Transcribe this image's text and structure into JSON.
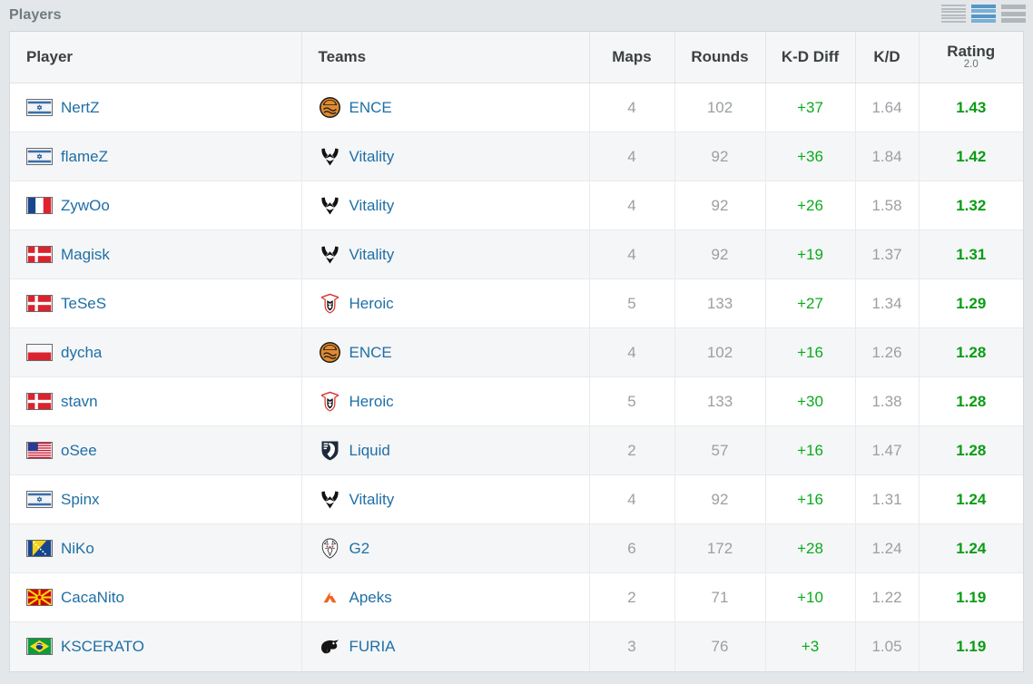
{
  "header": {
    "title": "Players",
    "view_toggles": [
      {
        "name": "compact-view-icon",
        "selected": false
      },
      {
        "name": "normal-view-icon",
        "selected": true
      },
      {
        "name": "large-view-icon",
        "selected": false
      }
    ]
  },
  "colors": {
    "page_bg": "#e3e7e9",
    "title": "#707b80",
    "link": "#1f6fa5",
    "muted_number": "#9b9fa3",
    "positive_green": "#0aab1b",
    "rating_green": "#099c14",
    "accent_blue": "#5596c4",
    "row_alt": "#f5f6f7"
  },
  "table": {
    "columns": [
      {
        "key": "player",
        "label": "Player",
        "align": "left"
      },
      {
        "key": "team",
        "label": "Teams",
        "align": "left"
      },
      {
        "key": "maps",
        "label": "Maps",
        "align": "center"
      },
      {
        "key": "rounds",
        "label": "Rounds",
        "align": "center"
      },
      {
        "key": "kd_diff",
        "label": "K-D Diff",
        "align": "center"
      },
      {
        "key": "kd",
        "label": "K/D",
        "align": "center"
      },
      {
        "key": "rating",
        "label": "Rating",
        "sublabel": "2.0",
        "align": "center"
      }
    ],
    "rows": [
      {
        "player": "NertZ",
        "country": "Israel",
        "team": "ENCE",
        "maps": "4",
        "rounds": "102",
        "kd_diff": "+37",
        "kd": "1.64",
        "rating": "1.43"
      },
      {
        "player": "flameZ",
        "country": "Israel",
        "team": "Vitality",
        "maps": "4",
        "rounds": "92",
        "kd_diff": "+36",
        "kd": "1.84",
        "rating": "1.42"
      },
      {
        "player": "ZywOo",
        "country": "France",
        "team": "Vitality",
        "maps": "4",
        "rounds": "92",
        "kd_diff": "+26",
        "kd": "1.58",
        "rating": "1.32"
      },
      {
        "player": "Magisk",
        "country": "Denmark",
        "team": "Vitality",
        "maps": "4",
        "rounds": "92",
        "kd_diff": "+19",
        "kd": "1.37",
        "rating": "1.31"
      },
      {
        "player": "TeSeS",
        "country": "Denmark",
        "team": "Heroic",
        "maps": "5",
        "rounds": "133",
        "kd_diff": "+27",
        "kd": "1.34",
        "rating": "1.29"
      },
      {
        "player": "dycha",
        "country": "Poland",
        "team": "ENCE",
        "maps": "4",
        "rounds": "102",
        "kd_diff": "+16",
        "kd": "1.26",
        "rating": "1.28"
      },
      {
        "player": "stavn",
        "country": "Denmark",
        "team": "Heroic",
        "maps": "5",
        "rounds": "133",
        "kd_diff": "+30",
        "kd": "1.38",
        "rating": "1.28"
      },
      {
        "player": "oSee",
        "country": "United States",
        "team": "Liquid",
        "maps": "2",
        "rounds": "57",
        "kd_diff": "+16",
        "kd": "1.47",
        "rating": "1.28"
      },
      {
        "player": "Spinx",
        "country": "Israel",
        "team": "Vitality",
        "maps": "4",
        "rounds": "92",
        "kd_diff": "+16",
        "kd": "1.31",
        "rating": "1.24"
      },
      {
        "player": "NiKo",
        "country": "Bosnia",
        "team": "G2",
        "maps": "6",
        "rounds": "172",
        "kd_diff": "+28",
        "kd": "1.24",
        "rating": "1.24"
      },
      {
        "player": "CacaNito",
        "country": "North Macedonia",
        "team": "Apeks",
        "maps": "2",
        "rounds": "71",
        "kd_diff": "+10",
        "kd": "1.22",
        "rating": "1.19"
      },
      {
        "player": "KSCERATO",
        "country": "Brazil",
        "team": "FURIA",
        "maps": "3",
        "rounds": "76",
        "kd_diff": "+3",
        "kd": "1.05",
        "rating": "1.19"
      }
    ]
  }
}
